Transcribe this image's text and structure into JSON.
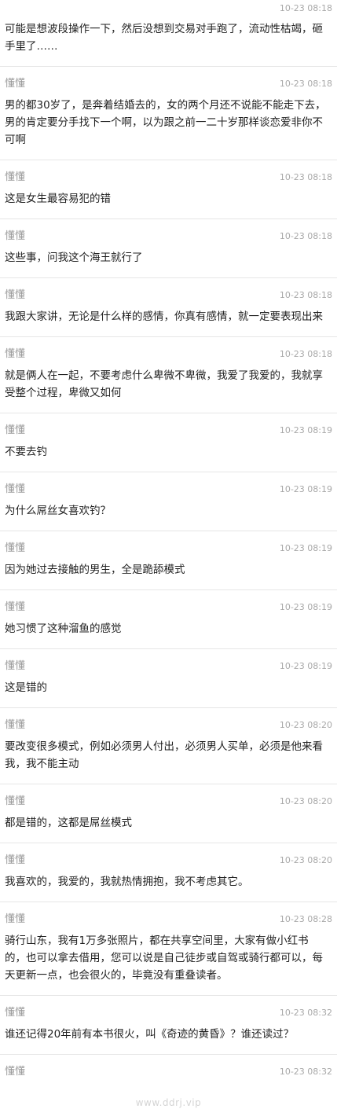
{
  "messages": [
    {
      "author": "",
      "time": "10-23 08:18",
      "text": "可能是想波段操作一下，然后没想到交易对手跑了，流动性枯竭，砸手里了……"
    },
    {
      "author": "懂懂",
      "time": "10-23 08:18",
      "text": "男的都30岁了，是奔着结婚去的，女的两个月还不说能不能走下去，男的肯定要分手找下一个啊，以为跟之前一二十岁那样谈恋爱非你不可啊"
    },
    {
      "author": "懂懂",
      "time": "10-23 08:18",
      "text": "这是女生最容易犯的错"
    },
    {
      "author": "懂懂",
      "time": "10-23 08:18",
      "text": "这些事，问我这个海王就行了"
    },
    {
      "author": "懂懂",
      "time": "10-23 08:18",
      "text": "我跟大家讲，无论是什么样的感情，你真有感情，就一定要表现出来"
    },
    {
      "author": "懂懂",
      "time": "10-23 08:18",
      "text": "就是俩人在一起，不要考虑什么卑微不卑微，我爱了我爱的，我就享受整个过程，卑微又如何"
    },
    {
      "author": "懂懂",
      "time": "10-23 08:19",
      "text": "不要去钓"
    },
    {
      "author": "懂懂",
      "time": "10-23 08:19",
      "text": "为什么屌丝女喜欢钓？"
    },
    {
      "author": "懂懂",
      "time": "10-23 08:19",
      "text": "因为她过去接触的男生，全是跪舔模式"
    },
    {
      "author": "懂懂",
      "time": "10-23 08:19",
      "text": "她习惯了这种溜鱼的感觉"
    },
    {
      "author": "懂懂",
      "time": "10-23 08:19",
      "text": "这是错的"
    },
    {
      "author": "懂懂",
      "time": "10-23 08:20",
      "text": "要改变很多模式，例如必须男人付出，必须男人买单，必须是他来看我，我不能主动"
    },
    {
      "author": "懂懂",
      "time": "10-23 08:20",
      "text": "都是错的，这都是屌丝模式"
    },
    {
      "author": "懂懂",
      "time": "10-23 08:20",
      "text": "我喜欢的，我爱的，我就热情拥抱，我不考虑其它。"
    },
    {
      "author": "懂懂",
      "time": "10-23 08:28",
      "text": "骑行山东，我有1万多张照片，都在共享空间里，大家有做小红书的，也可以拿去借用，您可以说是自己徒步或自驾或骑行都可以，每天更新一点，也会很火的，毕竟没有重叠读者。"
    },
    {
      "author": "懂懂",
      "time": "10-23 08:32",
      "text": "谁还记得20年前有本书很火，叫《奇迹的黄昏》？谁还读过？"
    },
    {
      "author": "懂懂",
      "time": "10-23 08:32",
      "text": ""
    }
  ],
  "watermark": "www.ddrj.vip"
}
